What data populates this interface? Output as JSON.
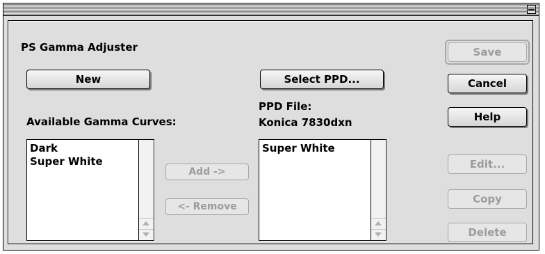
{
  "window": {
    "title": ""
  },
  "dialog": {
    "app_title": "PS Gamma Adjuster",
    "new_label": "New",
    "select_ppd_label": "Select PPD...",
    "available_label": "Available Gamma Curves:",
    "ppd_file_label": "PPD File:",
    "ppd_file_name": "Konica 7830dxn",
    "add_label": "Add ->",
    "remove_label": "<- Remove",
    "available_curves": [
      "Dark",
      "Super White"
    ],
    "selected_curves": [
      "Super White"
    ]
  },
  "sidebar": {
    "save_label": "Save",
    "cancel_label": "Cancel",
    "help_label": "Help",
    "edit_label": "Edit...",
    "copy_label": "Copy",
    "delete_label": "Delete"
  },
  "colors": {
    "window_bg": "#dedede",
    "disabled_text": "#9c9c9c"
  }
}
